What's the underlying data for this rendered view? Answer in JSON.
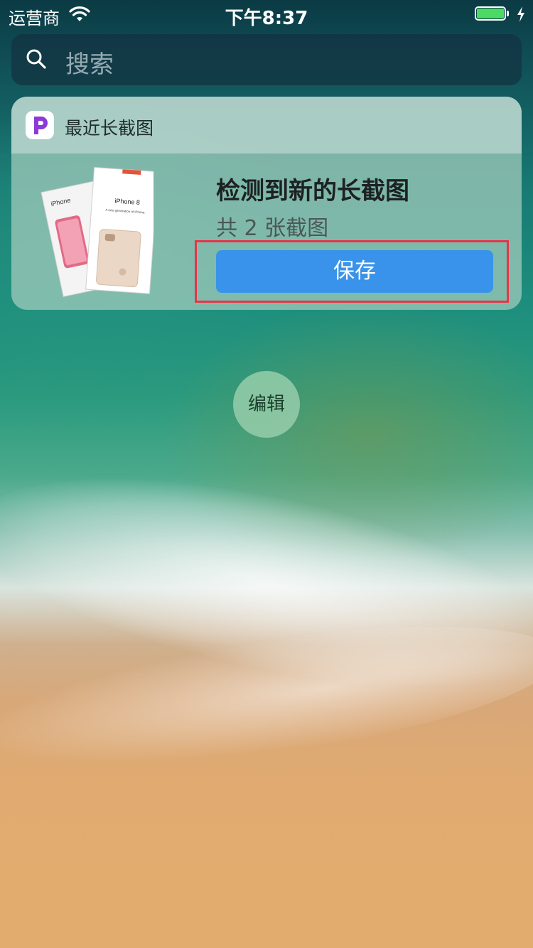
{
  "status_bar": {
    "carrier": "运营商",
    "time": "下午8:37",
    "battery_fill": 1.0,
    "charging": true
  },
  "search": {
    "placeholder": "搜索",
    "icon": "search-icon"
  },
  "widget": {
    "app_name": "最近长截图",
    "app_icon": "picsew-app-icon",
    "app_icon_color": "#8a3ad8",
    "thumbnail": {
      "back_label": "iPhone",
      "front_label": "iPhone 8",
      "front_caption": "A new generation of iPhone."
    },
    "headline": "检测到新的长截图",
    "subline": "共 2 张截图",
    "save_label": "保存",
    "save_color": "#3a93ea",
    "highlight_color": "#e8344a"
  },
  "edit_button": {
    "label": "编辑"
  }
}
